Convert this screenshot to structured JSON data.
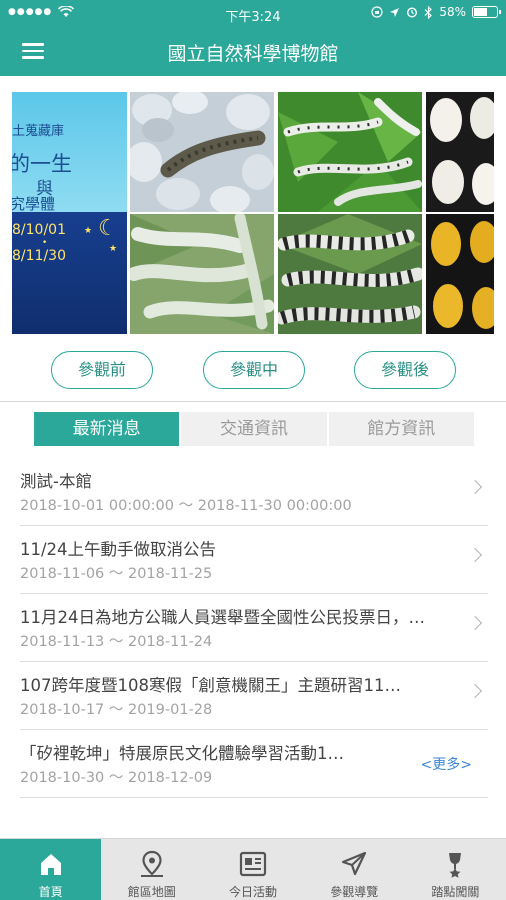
{
  "status_bar": {
    "time": "下午3:24",
    "battery_text": "58%",
    "battery_level": 0.58,
    "icons": [
      "signal-icon",
      "wifi-icon",
      "screen-lock-icon",
      "location-icon",
      "alarm-icon",
      "bluetooth-icon",
      "battery-icon"
    ]
  },
  "header": {
    "title": "國立自然科學博物館",
    "menu_icon": "hamburger-menu-icon"
  },
  "banner": {
    "poster_lines": [
      "土蒐藏庫",
      "的一生",
      "與",
      "究學體"
    ],
    "poster_dates": [
      "8/10/01",
      "8/11/30"
    ],
    "photos": [
      "silkworm-eggs-and-larva",
      "silkworms-on-leaves",
      "silk-cocoons-white",
      "pale-silkworms-on-leaves",
      "striped-silkworms",
      "silk-cocoons-yellow"
    ]
  },
  "visit_buttons": [
    "參觀前",
    "參觀中",
    "參觀後"
  ],
  "tabs": [
    {
      "label": "最新消息",
      "active": true
    },
    {
      "label": "交通資訊",
      "active": false
    },
    {
      "label": "館方資訊",
      "active": false
    }
  ],
  "news": [
    {
      "title": "測試-本館",
      "date": "2018-10-01 00:00:00 ～ 2018-11-30 00:00:00"
    },
    {
      "title": "11/24上午動手做取消公告",
      "date": "2018-11-06 ～ 2018-11-25"
    },
    {
      "title": "11月24日為地方公職人員選舉暨全國性公民投票日，…",
      "date": "2018-11-13 ～ 2018-11-24"
    },
    {
      "title": "107跨年度暨108寒假「創意機關王」主題研習11…",
      "date": "2018-10-17 ～ 2019-01-28"
    },
    {
      "title": "「矽裡乾坤」特展原民文化體驗學習活動1…",
      "date": "2018-10-30 ～ 2018-12-09"
    }
  ],
  "more_link": "<更多>",
  "bottom_nav": [
    {
      "label": "首頁",
      "icon": "home-icon",
      "active": true
    },
    {
      "label": "館區地圖",
      "icon": "map-pin-icon",
      "active": false
    },
    {
      "label": "今日活動",
      "icon": "calendar-news-icon",
      "active": false
    },
    {
      "label": "參觀導覽",
      "icon": "navigation-arrow-icon",
      "active": false
    },
    {
      "label": "踏點闖關",
      "icon": "trophy-icon",
      "active": false
    }
  ],
  "colors": {
    "primary": "#2ba89a",
    "more_link": "#3d86d9",
    "poster_date": "#ffe36b"
  }
}
